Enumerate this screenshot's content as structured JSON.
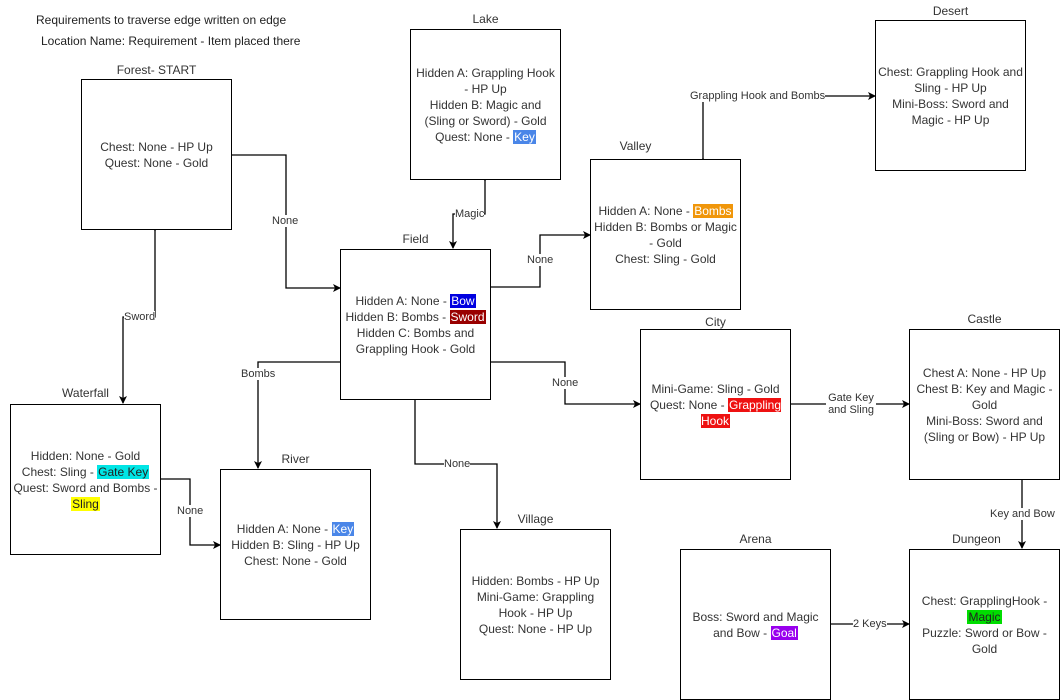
{
  "legend": {
    "line1": "Requirements to traverse edge written on edge",
    "line2": "Location Name: Requirement - Item placed there"
  },
  "highlight_colors": {
    "key": "#4a86e8",
    "bombs": "#f0960a",
    "bow": "#0000e0",
    "sword": "#990000",
    "grappling_hook": "#ee1111",
    "gate_key": "#00e5e5",
    "sling": "#ffff00",
    "goal": "#9900ee",
    "magic": "#00dd00"
  },
  "locations": {
    "forest": {
      "title": "Forest- START",
      "lines": [
        [
          {
            "t": "Chest: None - HP Up"
          }
        ],
        [
          {
            "t": "Quest: None - Gold"
          }
        ]
      ]
    },
    "lake": {
      "title": "Lake",
      "lines": [
        [
          {
            "t": "Hidden A: Grappling Hook - HP Up"
          }
        ],
        [
          {
            "t": "Hidden B: Magic and (Sling or Sword) - Gold"
          }
        ],
        [
          {
            "t": "Quest: None - "
          },
          {
            "t": "Key",
            "hl": "key"
          }
        ]
      ]
    },
    "desert": {
      "title": "Desert",
      "lines": [
        [
          {
            "t": "Chest: Grappling Hook and Sling - HP Up"
          }
        ],
        [
          {
            "t": "Mini-Boss: Sword and Magic - HP Up"
          }
        ]
      ]
    },
    "valley": {
      "title": "Valley",
      "lines": [
        [
          {
            "t": "Hidden A: None - "
          },
          {
            "t": "Bombs",
            "hl": "bombs"
          }
        ],
        [
          {
            "t": "Hidden B: Bombs or Magic - Gold"
          }
        ],
        [
          {
            "t": "Chest: Sling - Gold"
          }
        ]
      ]
    },
    "field": {
      "title": "Field",
      "lines": [
        [
          {
            "t": "Hidden A: None - "
          },
          {
            "t": "Bow",
            "hl": "bow"
          }
        ],
        [
          {
            "t": "Hidden B: Bombs - "
          },
          {
            "t": "Sword",
            "hl": "sword"
          }
        ],
        [
          {
            "t": "Hidden C: Bombs and Grappling Hook - Gold"
          }
        ]
      ]
    },
    "city": {
      "title": "City",
      "lines": [
        [
          {
            "t": "Mini-Game: Sling - Gold"
          }
        ],
        [
          {
            "t": "Quest: None - "
          },
          {
            "t": "Grappling Hook",
            "hl": "grappling_hook"
          }
        ]
      ]
    },
    "castle": {
      "title": "Castle",
      "lines": [
        [
          {
            "t": "Chest A: None - HP Up"
          }
        ],
        [
          {
            "t": "Chest B: Key and Magic - Gold"
          }
        ],
        [
          {
            "t": "Mini-Boss: Sword and (Sling or Bow) - HP Up"
          }
        ]
      ]
    },
    "waterfall": {
      "title": "Waterfall",
      "lines": [
        [
          {
            "t": "Hidden: None - Gold"
          }
        ],
        [
          {
            "t": "Chest: Sling - "
          },
          {
            "t": "Gate Key",
            "hl": "gate_key",
            "dark": true
          }
        ],
        [
          {
            "t": "Quest: Sword and Bombs - "
          },
          {
            "t": "Sling",
            "hl": "sling",
            "dark": true
          }
        ]
      ]
    },
    "river": {
      "title": "River",
      "lines": [
        [
          {
            "t": "Hidden A: None - "
          },
          {
            "t": "Key",
            "hl": "key"
          }
        ],
        [
          {
            "t": "Hidden B: Sling - HP Up"
          }
        ],
        [
          {
            "t": "Chest: None - Gold"
          }
        ]
      ]
    },
    "village": {
      "title": "Village",
      "lines": [
        [
          {
            "t": "Hidden: Bombs - HP Up"
          }
        ],
        [
          {
            "t": "Mini-Game: Grappling Hook - HP Up"
          }
        ],
        [
          {
            "t": "Quest: None - HP Up"
          }
        ]
      ]
    },
    "arena": {
      "title": "Arena",
      "lines": [
        [
          {
            "t": "Boss: Sword and Magic and Bow - "
          },
          {
            "t": "Goal",
            "hl": "goal"
          }
        ]
      ]
    },
    "dungeon": {
      "title": "Dungeon",
      "lines": [
        [
          {
            "t": "Chest: GrapplingHook - "
          },
          {
            "t": "Magic",
            "hl": "magic",
            "dark": true
          }
        ],
        [
          {
            "t": "Puzzle: Sword or Bow - Gold"
          }
        ]
      ]
    }
  },
  "edges": [
    {
      "id": "forest-field",
      "from": "Forest",
      "to": "Field",
      "label": "None",
      "bidirectional": true
    },
    {
      "id": "forest-waterfall",
      "from": "Forest",
      "to": "Waterfall",
      "label": "Sword",
      "bidirectional": true
    },
    {
      "id": "lake-field",
      "from": "Lake",
      "to": "Field",
      "label": "Magic",
      "bidirectional": true
    },
    {
      "id": "valley-desert",
      "from": "Valley",
      "to": "Desert",
      "label": "Grappling Hook and Bombs",
      "bidirectional": true
    },
    {
      "id": "field-valley",
      "from": "Field",
      "to": "Valley",
      "label": "None",
      "bidirectional": true
    },
    {
      "id": "field-river",
      "from": "Field",
      "to": "River",
      "label": "Bombs",
      "bidirectional": true
    },
    {
      "id": "field-city",
      "from": "Field",
      "to": "City",
      "label": "None",
      "bidirectional": true
    },
    {
      "id": "field-village",
      "from": "Field",
      "to": "Village",
      "label": "None",
      "bidirectional": true
    },
    {
      "id": "waterfall-river",
      "from": "Waterfall",
      "to": "River",
      "label": "None",
      "bidirectional": true
    },
    {
      "id": "city-castle",
      "from": "City",
      "to": "Castle",
      "label": "Gate Key and Sling",
      "bidirectional": true
    },
    {
      "id": "castle-dungeon",
      "from": "Castle",
      "to": "Dungeon",
      "label": "Key and Bow",
      "bidirectional": true
    },
    {
      "id": "arena-dungeon",
      "from": "Arena",
      "to": "Dungeon",
      "label": "2 Keys",
      "bidirectional": true
    }
  ]
}
